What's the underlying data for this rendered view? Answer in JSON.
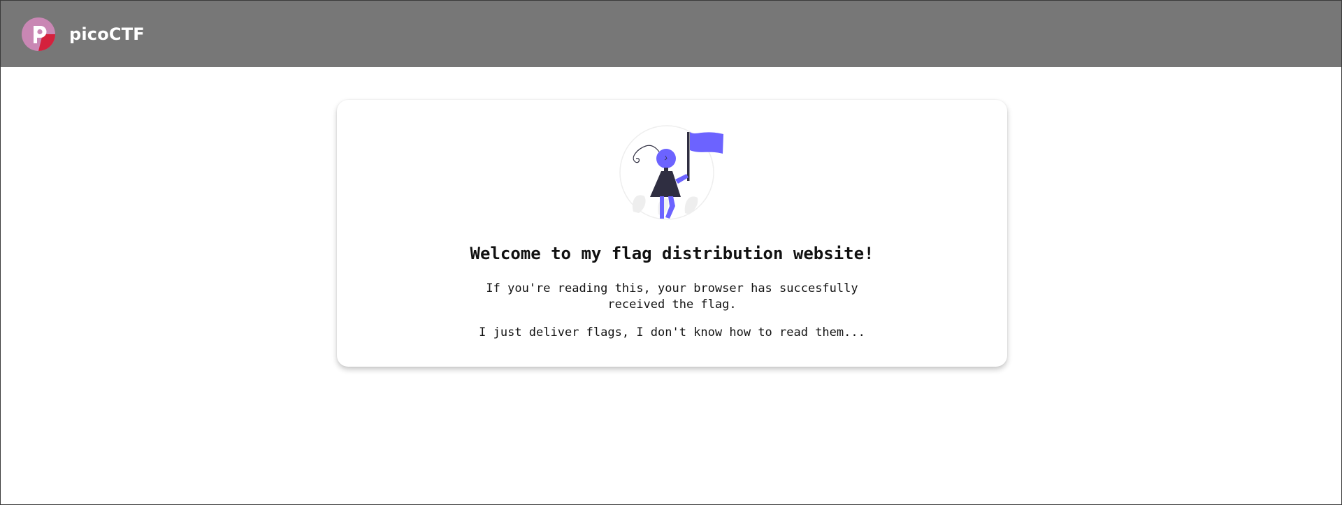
{
  "header": {
    "brand_name": "picoCTF",
    "logo_icon": "picoctf-logo-icon",
    "background_color": "#777777"
  },
  "main": {
    "illustration": "flag-bearer-illustration",
    "title": "Welcome to my flag distribution website!",
    "paragraph1_line1": "If you're reading this, your browser has succesfully",
    "paragraph1_line2": "received the flag.",
    "paragraph2": "I just deliver flags, I don't know how to read them..."
  },
  "colors": {
    "accent": "#6c63ff",
    "logo_red": "#d4213d",
    "logo_pink": "#c987b4"
  }
}
